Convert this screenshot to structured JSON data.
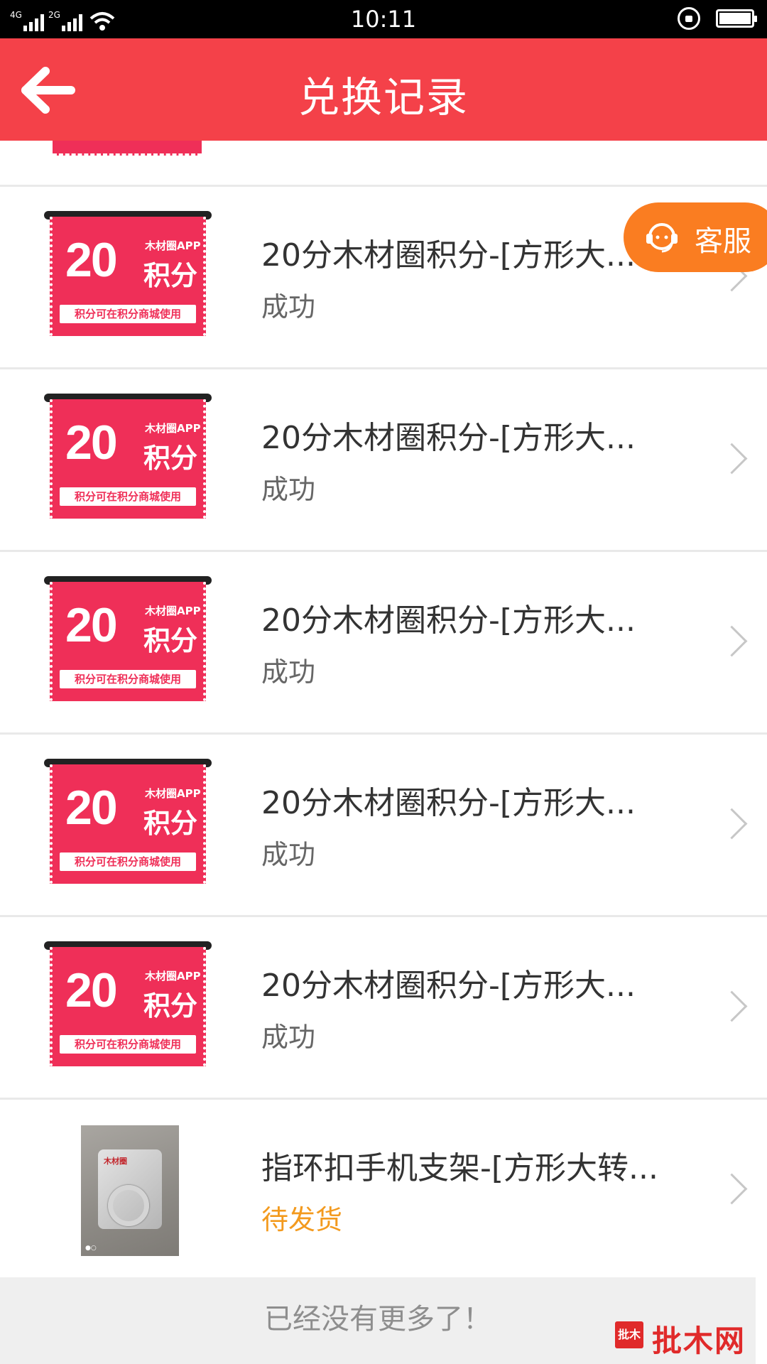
{
  "status_bar": {
    "signal_1": "4G",
    "signal_2": "2G",
    "time": "10:11"
  },
  "header": {
    "title": "兑换记录",
    "back_icon": "arrow-left-icon"
  },
  "ticket": {
    "number": "20",
    "brand": "木材圈APP",
    "unit": "积分",
    "footnote": "积分可在积分商城使用"
  },
  "items": [
    {
      "name": "20分木材圈积分-[方形大...",
      "status": "成功"
    },
    {
      "name": "20分木材圈积分-[方形大...",
      "status": "成功"
    },
    {
      "name": "20分木材圈积分-[方形大...",
      "status": "成功"
    },
    {
      "name": "20分木材圈积分-[方形大...",
      "status": "成功"
    },
    {
      "name": "20分木材圈积分-[方形大...",
      "status": "成功"
    },
    {
      "name": "指环扣手机支架-[方形大转...",
      "status": "待发货"
    }
  ],
  "photo": {
    "logo": "木材圈",
    "dots": "●○"
  },
  "floating": {
    "customer_service": "客服"
  },
  "footer": {
    "text": "已经没有更多了！"
  },
  "watermark": {
    "badge": "批木",
    "text": "批木网"
  },
  "colors": {
    "header": "#f44149",
    "ticket": "#ef2f58",
    "pending": "#f39a1e",
    "customer_service": "#fa7d21"
  }
}
